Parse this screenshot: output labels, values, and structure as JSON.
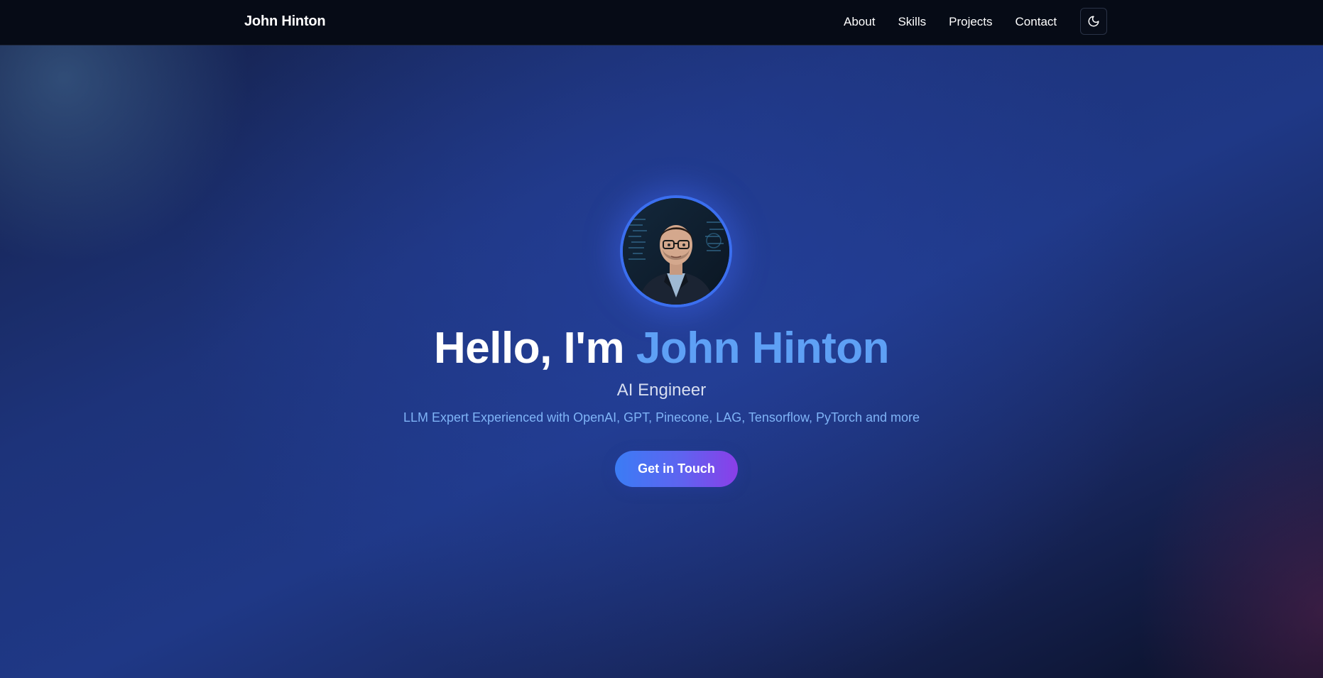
{
  "nav": {
    "brand": "John Hinton",
    "links": [
      "About",
      "Skills",
      "Projects",
      "Contact"
    ],
    "theme_toggle_icon": "moon-icon"
  },
  "hero": {
    "greeting": "Hello, I'm",
    "name": "John Hinton",
    "role": "AI Engineer",
    "tagline": "LLM Expert Experienced with OpenAI, GPT, Pinecone, LAG, Tensorflow, PyTorch and more",
    "cta_label": "Get in Touch",
    "avatar": "profile-photo"
  },
  "colors": {
    "accent": "#5ea0f5",
    "tagline": "#7fb4f7",
    "button_start": "#3b7cf5",
    "button_end": "#8a3ee8",
    "nav_bg": "#060b16"
  }
}
